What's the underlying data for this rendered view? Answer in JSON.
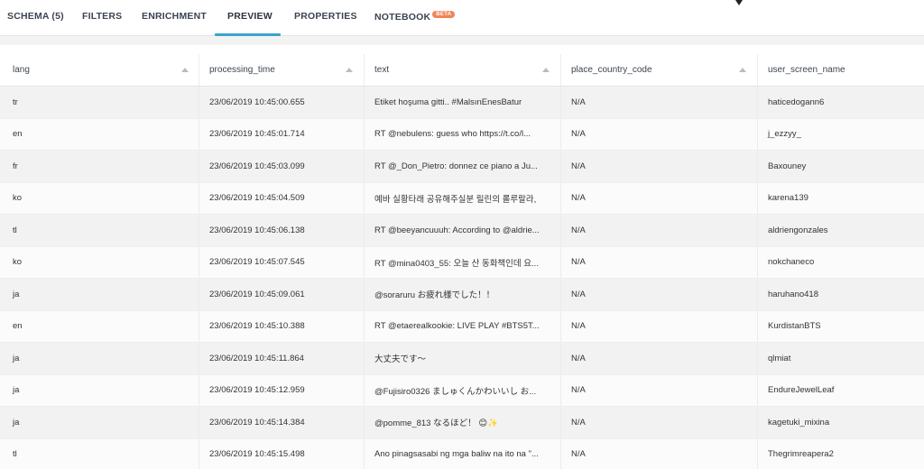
{
  "tabs": [
    {
      "label": "SCHEMA (5)"
    },
    {
      "label": "FILTERS"
    },
    {
      "label": "ENRICHMENT"
    },
    {
      "label": "PREVIEW"
    },
    {
      "label": "PROPERTIES"
    },
    {
      "label": "NOTEBOOK",
      "badge": "BETA"
    }
  ],
  "active_tab": "PREVIEW",
  "table": {
    "columns": [
      "lang",
      "processing_time",
      "text",
      "place_country_code",
      "user_screen_name"
    ],
    "rows": [
      [
        "tr",
        "23/06/2019 10:45:00.655",
        "Etiket hoşuma gitti.. #MalsınEnesBatur",
        "N/A",
        "haticedogann6"
      ],
      [
        "en",
        "23/06/2019 10:45:01.714",
        "RT @nebulens: guess who https://t.co/l...",
        "N/A",
        "j_ezzyy_"
      ],
      [
        "fr",
        "23/06/2019 10:45:03.099",
        "RT @_Don_Pietro: donnez ce piano a Ju...",
        "N/A",
        "Baxouney"
      ],
      [
        "ko",
        "23/06/2019 10:45:04.509",
        "예바 실황타래 공유해주실분 릴린의 롤루랄라,",
        "N/A",
        "karena139"
      ],
      [
        "tl",
        "23/06/2019 10:45:06.138",
        "RT @beeyancuuuh: According to @aldrie...",
        "N/A",
        "aldriengonzales"
      ],
      [
        "ko",
        "23/06/2019 10:45:07.545",
        "RT @mina0403_55: 오늘 산 동화책인데 요...",
        "N/A",
        "nokchaneco"
      ],
      [
        "ja",
        "23/06/2019 10:45:09.061",
        "@soraruru お疲れ様でした！！",
        "N/A",
        "haruhano418"
      ],
      [
        "en",
        "23/06/2019 10:45:10.388",
        "RT @etaerealkookie: LIVE PLAY #BTS5T...",
        "N/A",
        "KurdistanBTS"
      ],
      [
        "ja",
        "23/06/2019 10:45:11.864",
        "大丈夫です～",
        "N/A",
        "qlmiat"
      ],
      [
        "ja",
        "23/06/2019 10:45:12.959",
        "@Fujisiro0326 ましゅくんかわいいし お...",
        "N/A",
        "EndureJewelLeaf"
      ],
      [
        "ja",
        "23/06/2019 10:45:14.384",
        "@pomme_813 なるほど！ 😊✨",
        "N/A",
        "kagetuki_mixina"
      ],
      [
        "tl",
        "23/06/2019 10:45:15.498",
        "Ano pinagsasabi ng mga baliw na ito na \"...",
        "N/A",
        "Thegrimreapera2"
      ]
    ]
  }
}
